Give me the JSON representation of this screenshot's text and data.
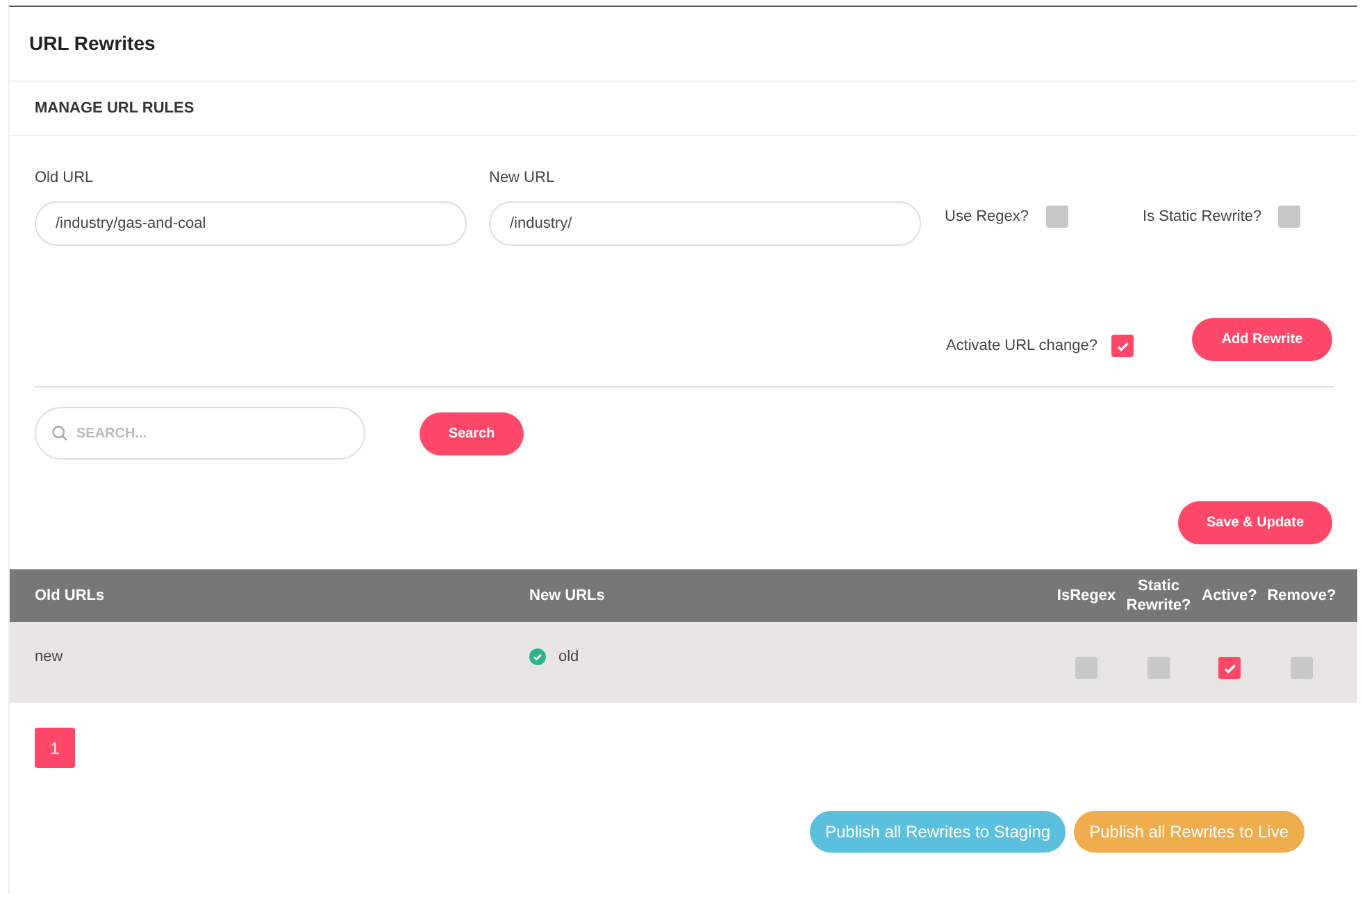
{
  "page": {
    "title": "URL Rewrites"
  },
  "section": {
    "title": "MANAGE URL RULES"
  },
  "form": {
    "old_url": {
      "label": "Old URL",
      "value": "/industry/gas-and-coal"
    },
    "new_url": {
      "label": "New URL",
      "value": "/industry/"
    },
    "use_regex": {
      "label": "Use Regex?",
      "checked": false
    },
    "is_static": {
      "label": "Is Static Rewrite?",
      "checked": false
    },
    "activate": {
      "label": "Activate URL change?",
      "checked": true
    },
    "add_button": "Add Rewrite"
  },
  "search": {
    "placeholder": "SEARCH...",
    "button": "Search"
  },
  "save_button": "Save & Update",
  "table": {
    "columns": [
      "Old URLs",
      "New URLs",
      "IsRegex",
      "Static Rewrite?",
      "Active?",
      "Remove?"
    ],
    "rows": [
      {
        "old_url": "new",
        "new_url": "old",
        "is_regex": false,
        "static": false,
        "active": true,
        "remove": false
      }
    ]
  },
  "pagination": [
    {
      "label": "1",
      "selected": true
    }
  ],
  "publish": [
    {
      "label": "Publish all Rewrites to Staging",
      "kind": "staging"
    },
    {
      "label": "Publish all Rewrites to Live",
      "kind": "live"
    }
  ]
}
